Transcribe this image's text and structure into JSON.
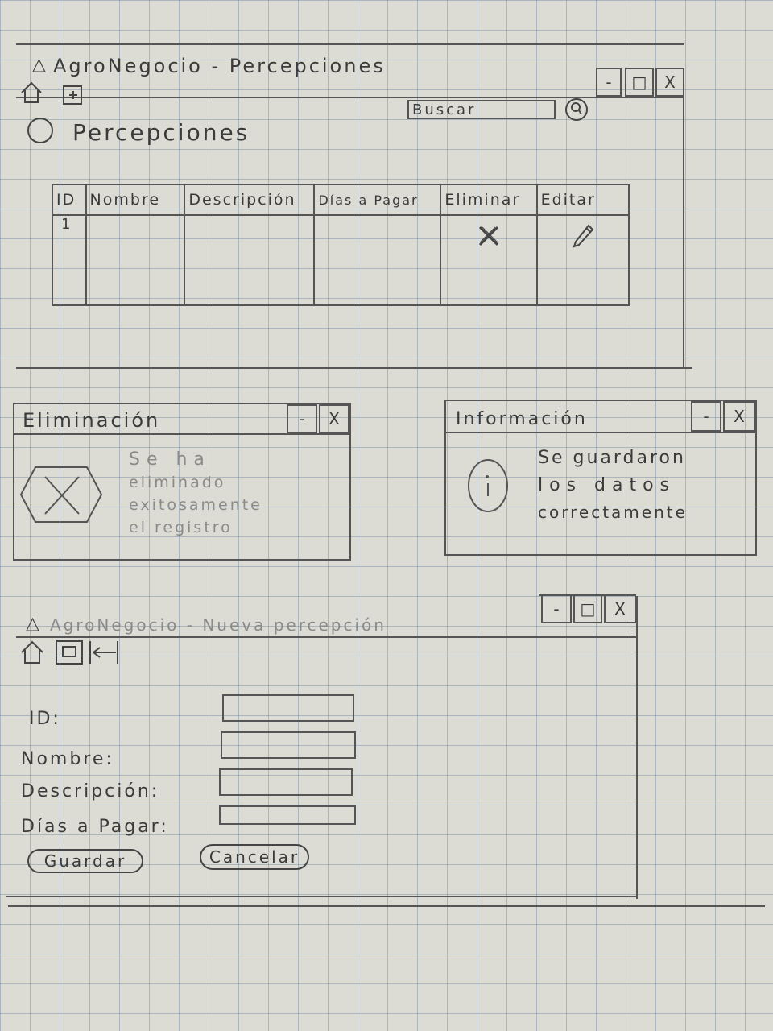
{
  "main_window": {
    "title": "AgroNegocio - Percepciones",
    "search_label": "Buscar",
    "page_title": "Percepciones",
    "minimize_label": "-",
    "maximize_label": "□",
    "close_label": "X",
    "table": {
      "columns": [
        "ID",
        "Nombre",
        "Descripción",
        "Días a Pagar",
        "Eliminar",
        "Editar"
      ],
      "rows": [
        {
          "id": "1",
          "nombre": "",
          "descripcion": "",
          "dias": ""
        }
      ]
    }
  },
  "delete_dialog": {
    "title": "Eliminación",
    "minimize_label": "-",
    "close_label": "X",
    "message_lines": [
      "Se ha",
      "eliminado",
      "exitosamente",
      "el registro"
    ]
  },
  "info_dialog": {
    "title": "Información",
    "minimize_label": "-",
    "close_label": "X",
    "message_lines": [
      "Se guardaron",
      "los datos",
      "correctamente"
    ]
  },
  "form_window": {
    "title": "AgroNegocio - Nueva percepción",
    "minimize_label": "-",
    "maximize_label": "□",
    "close_label": "X",
    "fields": [
      {
        "label": "ID:",
        "value": ""
      },
      {
        "label": "Nombre:",
        "value": ""
      },
      {
        "label": "Descripción:",
        "value": ""
      },
      {
        "label": "Días a Pagar:",
        "value": ""
      }
    ],
    "save_label": "Guardar",
    "cancel_label": "Cancelar"
  },
  "colors": {
    "paper": "#dcdcd4",
    "grid": "#6e8aa8",
    "pencil": "#555555"
  }
}
